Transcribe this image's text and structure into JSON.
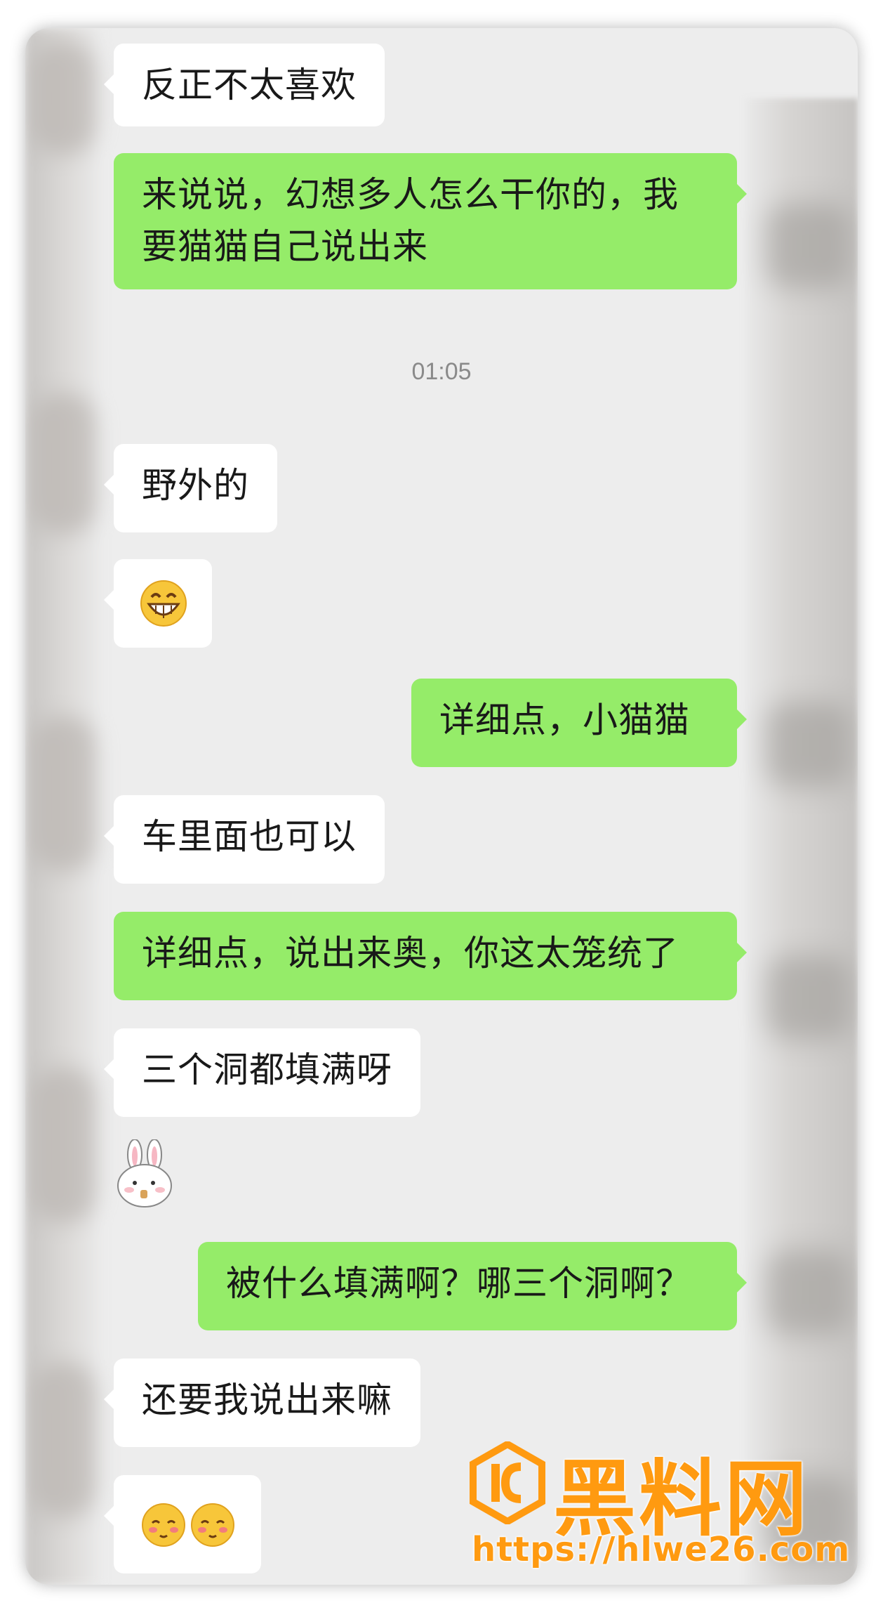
{
  "chat": {
    "messages": [
      {
        "from": "them",
        "text": "反正不太喜欢"
      },
      {
        "from": "me",
        "text": "来说说，幻想多人怎么干你的，我要猫猫自己说出来"
      },
      {
        "type": "time",
        "text": "01:05"
      },
      {
        "from": "them",
        "text": "野外的"
      },
      {
        "from": "them",
        "type": "emoji",
        "icon": "grinning-face-emoji"
      },
      {
        "from": "me",
        "text": "详细点，小猫猫"
      },
      {
        "from": "them",
        "text": "车里面也可以"
      },
      {
        "from": "me",
        "text": "详细点，说出来奥，你这太笼统了"
      },
      {
        "from": "them",
        "text": "三个洞都填满呀"
      },
      {
        "from": "them",
        "type": "sticker",
        "icon": "bunny-sticker-icon"
      },
      {
        "from": "me",
        "text": "被什么填满啊？哪三个洞啊？"
      },
      {
        "from": "them",
        "text": "还要我说出来嘛"
      },
      {
        "from": "them",
        "type": "emoji",
        "icon": "shy-faces-emoji"
      }
    ]
  },
  "watermark": {
    "brand": "黑料网",
    "url": "https://hlwe26.com",
    "color": "#ff9a10"
  },
  "colors": {
    "background": "#ededed",
    "incoming_bubble": "#ffffff",
    "outgoing_bubble": "#95ec69"
  }
}
